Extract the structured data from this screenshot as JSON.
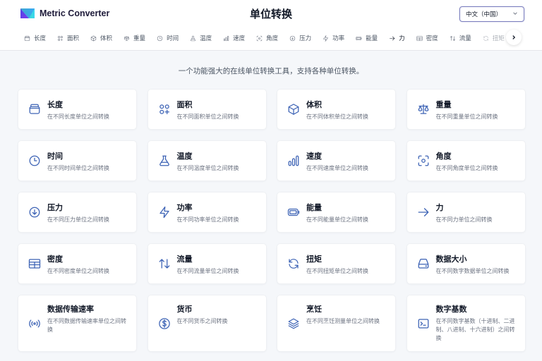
{
  "header": {
    "app_name": "Metric Converter",
    "page_title": "单位转换",
    "language": "中文（中国）"
  },
  "tabs": [
    {
      "label": "长度",
      "icon": "jar-icon"
    },
    {
      "label": "面积",
      "icon": "grid-plus-icon"
    },
    {
      "label": "体积",
      "icon": "cube-icon"
    },
    {
      "label": "重量",
      "icon": "scale-icon"
    },
    {
      "label": "时间",
      "icon": "clock-icon"
    },
    {
      "label": "温度",
      "icon": "flask-icon"
    },
    {
      "label": "速度",
      "icon": "bars-icon"
    },
    {
      "label": "角度",
      "icon": "focus-icon"
    },
    {
      "label": "压力",
      "icon": "arrow-down-circle-icon"
    },
    {
      "label": "功率",
      "icon": "bolt-icon"
    },
    {
      "label": "能量",
      "icon": "battery-icon"
    },
    {
      "label": "力",
      "icon": "arrow-right-icon",
      "active": true
    },
    {
      "label": "密度",
      "icon": "table-icon"
    },
    {
      "label": "流量",
      "icon": "arrows-updown-icon"
    },
    {
      "label": "扭矩",
      "icon": "refresh-icon"
    }
  ],
  "subtitle": "一个功能强大的在线单位转换工具，支持各种单位转换。",
  "categories": [
    {
      "name": "长度",
      "desc": "在不同长度单位之间转换",
      "icon": "jar-icon"
    },
    {
      "name": "面积",
      "desc": "在不同面积单位之间转换",
      "icon": "grid-plus-icon"
    },
    {
      "name": "体积",
      "desc": "在不同体积单位之间转换",
      "icon": "cube-icon"
    },
    {
      "name": "重量",
      "desc": "在不同重量单位之间转换",
      "icon": "scale-icon"
    },
    {
      "name": "时间",
      "desc": "在不同时间单位之间转换",
      "icon": "clock-icon"
    },
    {
      "name": "温度",
      "desc": "在不同温度单位之间转换",
      "icon": "flask-icon"
    },
    {
      "name": "速度",
      "desc": "在不同速度单位之间转换",
      "icon": "bars-icon"
    },
    {
      "name": "角度",
      "desc": "在不同角度单位之间转换",
      "icon": "focus-icon"
    },
    {
      "name": "压力",
      "desc": "在不同压力单位之间转换",
      "icon": "arrow-down-circle-icon"
    },
    {
      "name": "功率",
      "desc": "在不同功率单位之间转换",
      "icon": "bolt-icon"
    },
    {
      "name": "能量",
      "desc": "在不同能量单位之间转换",
      "icon": "battery-icon"
    },
    {
      "name": "力",
      "desc": "在不同力单位之间转换",
      "icon": "arrow-right-icon"
    },
    {
      "name": "密度",
      "desc": "在不同密度单位之间转换",
      "icon": "table-icon"
    },
    {
      "name": "流量",
      "desc": "在不同流量单位之间转换",
      "icon": "arrows-updown-icon"
    },
    {
      "name": "扭矩",
      "desc": "在不同扭矩单位之间转换",
      "icon": "refresh-icon"
    },
    {
      "name": "数据大小",
      "desc": "在不同数字数据单位之间转换",
      "icon": "drive-icon"
    },
    {
      "name": "数据传输速率",
      "desc": "在不同数据传输速率单位之间转换",
      "icon": "signal-icon"
    },
    {
      "name": "货币",
      "desc": "在不同货币之间转换",
      "icon": "dollar-icon"
    },
    {
      "name": "烹饪",
      "desc": "在不同烹饪测量单位之间转换",
      "icon": "layers-icon"
    },
    {
      "name": "数字基数",
      "desc": "在不同数字基数（十进制、二进制、八进制、十六进制）之间转换",
      "icon": "terminal-icon"
    }
  ],
  "colors": {
    "accent": "#3d63b5",
    "background": "#f5f7fa",
    "card": "#ffffff"
  }
}
